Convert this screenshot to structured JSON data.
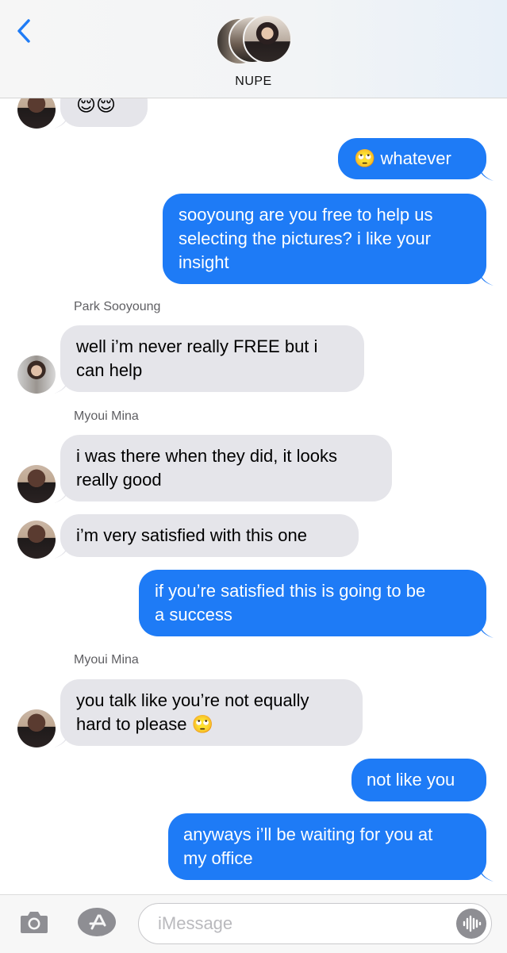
{
  "header": {
    "group_name": "NUPE"
  },
  "messages": [
    {
      "direction": "in",
      "sender": "",
      "text": "😌😌"
    },
    {
      "direction": "out",
      "text": "🙄 whatever"
    },
    {
      "direction": "out",
      "text_lines": [
        "sooyoung are you free to help us",
        "selecting the pictures? i like your",
        "insight"
      ]
    },
    {
      "direction": "in",
      "sender": "Park Sooyoung",
      "text_lines": [
        "well i’m never really FREE but i",
        "can help"
      ]
    },
    {
      "direction": "in",
      "sender": "Myoui Mina",
      "text_lines": [
        "i was there when they did, it looks",
        "really good"
      ]
    },
    {
      "direction": "in",
      "sender": "",
      "text": "i’m very satisfied with this one"
    },
    {
      "direction": "out",
      "text_lines": [
        "if you’re satisfied this is going to be",
        "a success"
      ]
    },
    {
      "direction": "in",
      "sender": "Myoui Mina",
      "text_lines": [
        "you talk like you’re not equally",
        "hard to please 🙄"
      ]
    },
    {
      "direction": "out",
      "text": "not like you"
    },
    {
      "direction": "out",
      "text_lines": [
        "anyways i’ll be waiting for you at",
        "my office"
      ]
    }
  ],
  "input": {
    "placeholder": "iMessage"
  },
  "colors": {
    "outgoing": "#1e7bf6",
    "incoming": "#e5e5ea",
    "accent": "#1f7cf6"
  },
  "icons": [
    "back-chevron-icon",
    "camera-icon",
    "app-store-icon",
    "audio-waveform-icon"
  ]
}
